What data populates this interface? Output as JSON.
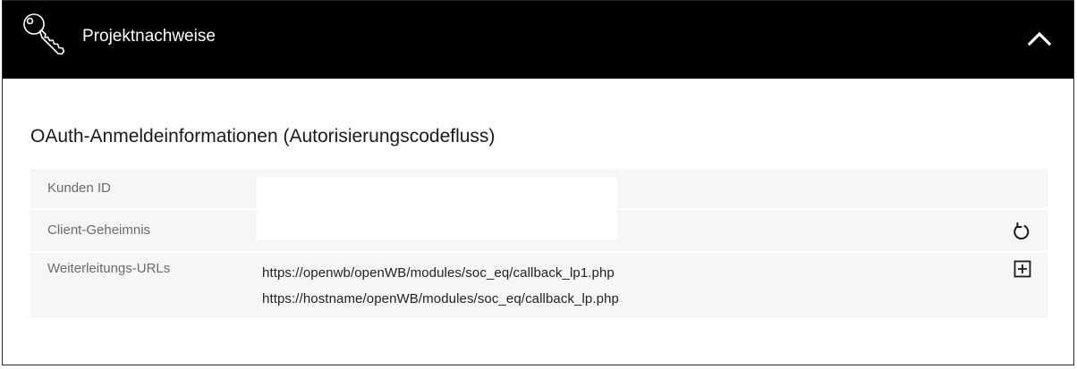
{
  "header": {
    "title": "Projektnachweise",
    "icon": "key-icon",
    "toggle_icon": "chevron-up-icon"
  },
  "section": {
    "title": "OAuth-Anmeldeinformationen (Autorisierungscodefluss)"
  },
  "rows": [
    {
      "label": "Kunden ID"
    },
    {
      "label": "Client-Geheimnis",
      "action_icon": "refresh-icon"
    },
    {
      "label": "Weiterleitungs-URLs",
      "action_icon": "add-icon",
      "urls": [
        "https://openwb/openWB/modules/soc_eq/callback_lp1.php",
        "https://hostname/openWB/modules/soc_eq/callback_lp.php"
      ]
    }
  ],
  "colors": {
    "header_bg": "#000000",
    "row_bg": "#f6f6f6",
    "label_text": "#6b6b6b"
  }
}
